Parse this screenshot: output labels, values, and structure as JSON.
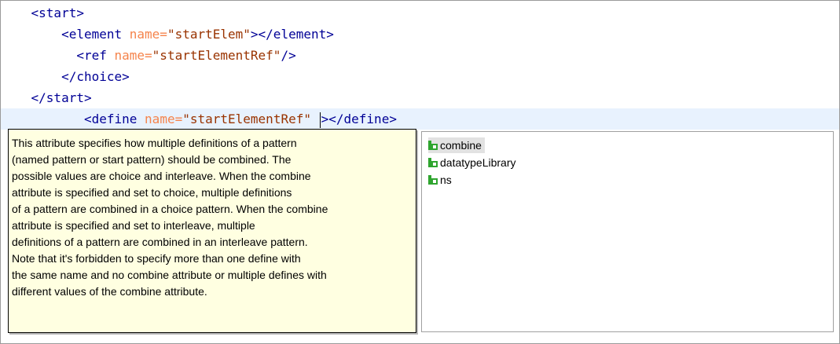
{
  "editor": {
    "lines": [
      {
        "indent": "    ",
        "tag_open": "<start>"
      },
      {
        "indent": "        ",
        "tag_open": "<element",
        "attr": "name=",
        "value": "\"startElem\"",
        "tag_close": "></element>"
      },
      {
        "indent": "          ",
        "tag_open": "<ref",
        "attr": "name=",
        "value": "\"startElementRef\"",
        "tag_close": "/>"
      },
      {
        "indent": "        ",
        "tag_open": "</choice>"
      },
      {
        "indent": "    ",
        "tag_open": "</start>"
      },
      {
        "indent": "           ",
        "tag_open": "<define",
        "attr": "name=",
        "value": "\"startElementRef\"",
        "space": " ",
        "tag_close": "></define>"
      }
    ]
  },
  "tooltip": {
    "lines": [
      "This attribute specifies how multiple definitions of a pattern",
      "(named pattern or start pattern) should be combined. The",
      "possible values are choice and interleave. When the combine",
      "attribute is specified and set to choice, multiple definitions",
      "of a pattern are combined in a choice pattern. When the combine",
      "attribute is specified and set to interleave, multiple",
      "definitions of a pattern are combined in an interleave pattern.",
      "Note that it's forbidden to specify more than one define with",
      "the same name and no combine attribute or multiple defines with",
      "different values of the combine attribute."
    ]
  },
  "proposals": {
    "items": [
      {
        "label": "combine",
        "icon": "attribute-icon",
        "selected": true
      },
      {
        "label": "datatypeLibrary",
        "icon": "attribute-icon",
        "selected": false
      },
      {
        "label": "ns",
        "icon": "attribute-icon",
        "selected": false
      }
    ],
    "icon_color": "#2fa52f"
  }
}
